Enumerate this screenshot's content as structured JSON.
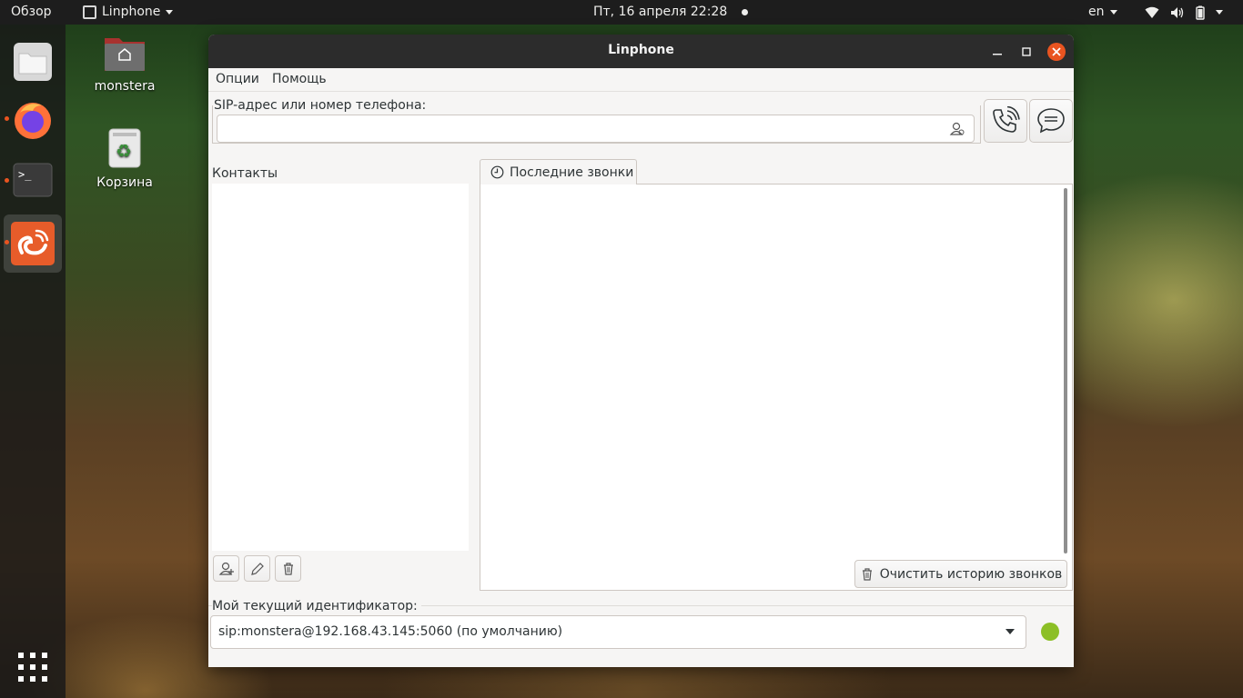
{
  "topbar": {
    "activities": "Обзор",
    "app_name": "Linphone",
    "clock": "Пт, 16 апреля  22:28",
    "language": "en",
    "tray_icons": [
      "wifi-icon",
      "volume-icon",
      "battery-icon",
      "power-menu-caret"
    ]
  },
  "dock": {
    "items": [
      "files-icon",
      "firefox-icon",
      "terminal-icon",
      "linphone-icon"
    ],
    "show_apps": "grid-icon"
  },
  "desktop": {
    "icons": [
      {
        "label": "monstera",
        "icon": "home-folder-icon"
      },
      {
        "label": "Корзина",
        "icon": "trash-icon"
      }
    ]
  },
  "window": {
    "title": "Linphone",
    "menu": [
      "Опции",
      "Помощь"
    ],
    "sip": {
      "label": "SIP-адрес или номер телефона:",
      "value": "",
      "placeholder": ""
    },
    "contacts": {
      "title": "Контакты",
      "buttons": [
        "add-contact-icon",
        "edit-contact-icon",
        "delete-contact-icon"
      ]
    },
    "calls": {
      "tab_label": "Последние звонки",
      "clear_label": "Очистить историю звонков"
    },
    "identity": {
      "label": "Мой текущий идентификатор:",
      "value": "sip:monstera@192.168.43.145:5060 (по умолчанию)",
      "status_color": "#8cbf26"
    }
  },
  "colors": {
    "accent": "#e95420",
    "topbar_bg": "#1d1d1d",
    "titlebar_bg": "#2c2c2c",
    "window_bg": "#f6f5f4"
  }
}
